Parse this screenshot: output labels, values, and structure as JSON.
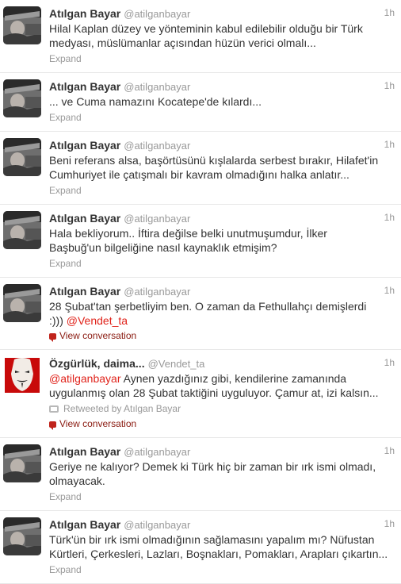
{
  "tweets": [
    {
      "name": "Atılgan Bayar",
      "handle": "@atilganbayar",
      "time": "1h",
      "lines": [
        "Hilal Kaplan düzey ve yönteminin kabul edilebilir olduğu bir Türk",
        "medyası, müslümanlar açısından hüzün verici olmalı..."
      ],
      "expand": "Expand"
    },
    {
      "name": "Atılgan Bayar",
      "handle": "@atilganbayar",
      "time": "1h",
      "lines": [
        "... ve Cuma namazını Kocatepe'de kılardı..."
      ],
      "expand": "Expand"
    },
    {
      "name": "Atılgan Bayar",
      "handle": "@atilganbayar",
      "time": "1h",
      "lines": [
        "Beni referans alsa, başörtüsünü kışlalarda serbest bırakır, Hilafet'in",
        "Cumhuriyet ile çatışmalı bir kavram olmadığını halka anlatır..."
      ],
      "expand": "Expand"
    },
    {
      "name": "Atılgan Bayar",
      "handle": "@atilganbayar",
      "time": "1h",
      "lines": [
        "Hala bekliyorum.. İftira değilse belki unutmuşumdur, İlker",
        "Başbuğ'un bilgeliğine nasıl kaynaklık etmişim?"
      ],
      "expand": "Expand"
    },
    {
      "name": "Atılgan Bayar",
      "handle": "@atilganbayar",
      "time": "1h",
      "line1": "28 Şubat'tan şerbetliyim ben. O zaman da Fethullahçı demişlerdi",
      "line2_text": ":))) ",
      "line2_mention": "@Vendet_ta",
      "conversation": "View conversation"
    },
    {
      "name": "Özgürlük, daima...",
      "handle": "@Vendet_ta",
      "time": "1h",
      "line1_mention": "@atilganbayar",
      "line1_text": " Aynen yazdığınız gibi, kendilerine zamanında",
      "line2": "uygulanmış olan 28 Şubat taktiğini uyguluyor. Çamur at, izi kalsın...",
      "retweeted_by": "Retweeted by Atılgan Bayar",
      "conversation": "View conversation"
    },
    {
      "name": "Atılgan Bayar",
      "handle": "@atilganbayar",
      "time": "1h",
      "lines": [
        "Geriye ne kalıyor? Demek ki Türk hiç bir zaman bir ırk ismi olmadı,",
        "olmayacak."
      ],
      "expand": "Expand"
    },
    {
      "name": "Atılgan Bayar",
      "handle": "@atilganbayar",
      "time": "1h",
      "lines": [
        "Türk'ün bir ırk ismi olmadığının sağlamasını yapalım mı? Nüfustan",
        "Kürtleri, Çerkesleri, Lazları, Boşnakları, Pomakları, Arapları çıkartın..."
      ],
      "expand": "Expand"
    }
  ]
}
